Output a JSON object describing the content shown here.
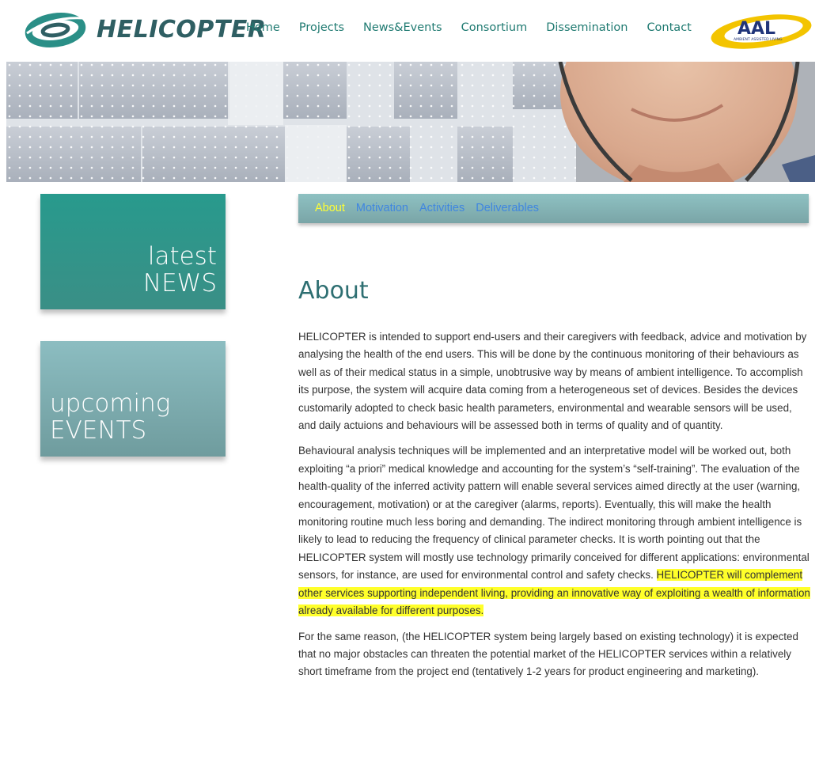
{
  "header": {
    "logo_text": "HELICOPTER",
    "nav": [
      "Home",
      "Projects",
      "News&Events",
      "Consortium",
      "Dissemination",
      "Contact"
    ],
    "partner_logo_text": "AAL",
    "partner_logo_tagline": "AMBIENT ASSISTED LIVING"
  },
  "sidebar": {
    "news": {
      "line1": "latest",
      "line2": "NEWS"
    },
    "events": {
      "line1": "upcoming",
      "line2": "EVENTS"
    }
  },
  "subnav": {
    "items": [
      "About",
      "Motivation",
      "Activities",
      "Deliverables"
    ],
    "active": "About"
  },
  "main": {
    "title": "About",
    "p1": "HELICOPTER is intended to support end-users and their caregivers with feedback, advice  and motivation by analysing the health of the end users. This will be done by the continuous monitoring of their  behaviours as well as of their medical status in a simple, unobtrusive way by means of ambient intelligence. To accomplish its purpose, the system will acquire data coming from a heterogeneous set of devices. Besides the devices customarily adopted to check basic health parameters, environmental and wearable sensors will be used, and daily actuions and  behaviours  will be assessed both in terms of quality and of quantity.",
    "p2": "Behavioural analysis techniques will be implemented and an interpretative model will be worked out, both exploiting “a priori” medical knowledge and accounting for the system’s “self-training”. The evaluation of the health-quality of the inferred activity pattern will enable several services aimed directly at the user (warning, encouragement, motivation) or at the caregiver (alarms, reports). Eventually, this will make the health monitoring routine much less boring and demanding. The  indirect monitoring through ambient intelligence is likely to lead to reducing the frequency of clinical parameter checks. It is worth pointing out that the HELICOPTER system will mostly use technology primarily conceived for different applications: environmental sensors, for instance, are used for environmental control and safety checks. ",
    "p2_highlight": "HELICOPTER will complement  other services supporting independent living,  providing an innovative way of exploiting a wealth of information already available for different purposes.",
    "p3": "For the same reason, (the HELICOPTER system being largely based on existing technology) it is expected that no major obstacles can threaten the potential market  of the HELICOPTER services within a relatively short timeframe from the project end (tentatively 1-2 years for product engineering and marketing)."
  },
  "colors": {
    "nav_link": "#1f7a71",
    "news_box": "#289a8d",
    "events_box": "#8cbdc1",
    "subnav_active": "#ffff33",
    "subnav_link": "#3f86e0",
    "highlight": "#ffff2a",
    "title": "#2e6f72"
  }
}
